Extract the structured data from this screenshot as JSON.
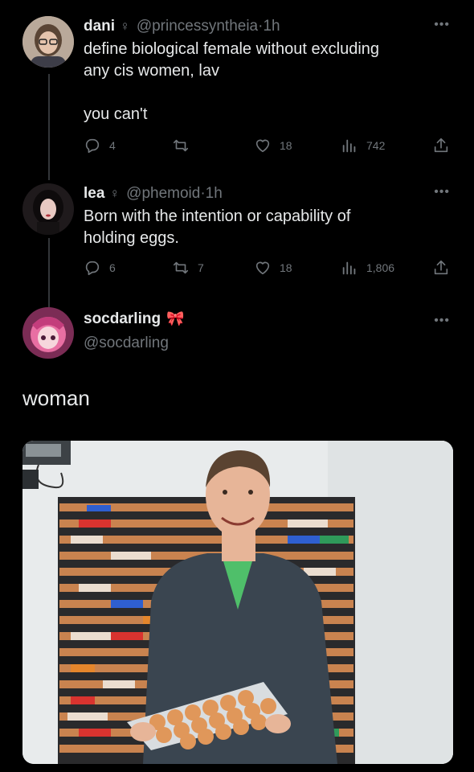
{
  "tweets": [
    {
      "name": "dani",
      "gender": "♀",
      "handle": "@princessyntheia",
      "dot": "·",
      "time": "1h",
      "text_line1": "define biological female without excluding",
      "text_line2": "any cis women, lav",
      "text_line3": "you can't",
      "replies": "4",
      "retweets": "",
      "likes": "18",
      "views": "742"
    },
    {
      "name": "lea",
      "gender": "♀",
      "handle": "@phemoid",
      "dot": "·",
      "time": "1h",
      "text_line1": "Born with the intention or capability of",
      "text_line2": "holding eggs.",
      "replies": "6",
      "retweets": "7",
      "likes": "18",
      "views": "1,806"
    },
    {
      "name": "socdarling",
      "emoji": "🎀",
      "handle": "@socdarling",
      "text": "woman"
    }
  ],
  "icons": {
    "reply": "reply-icon",
    "retweet": "retweet-icon",
    "like": "heart-icon",
    "views": "views-icon",
    "share": "share-icon",
    "more": "more-icon"
  },
  "colors": {
    "background": "#000000",
    "text": "#e7e9ea",
    "muted": "#71767b",
    "bow": "#ff6fa8"
  }
}
